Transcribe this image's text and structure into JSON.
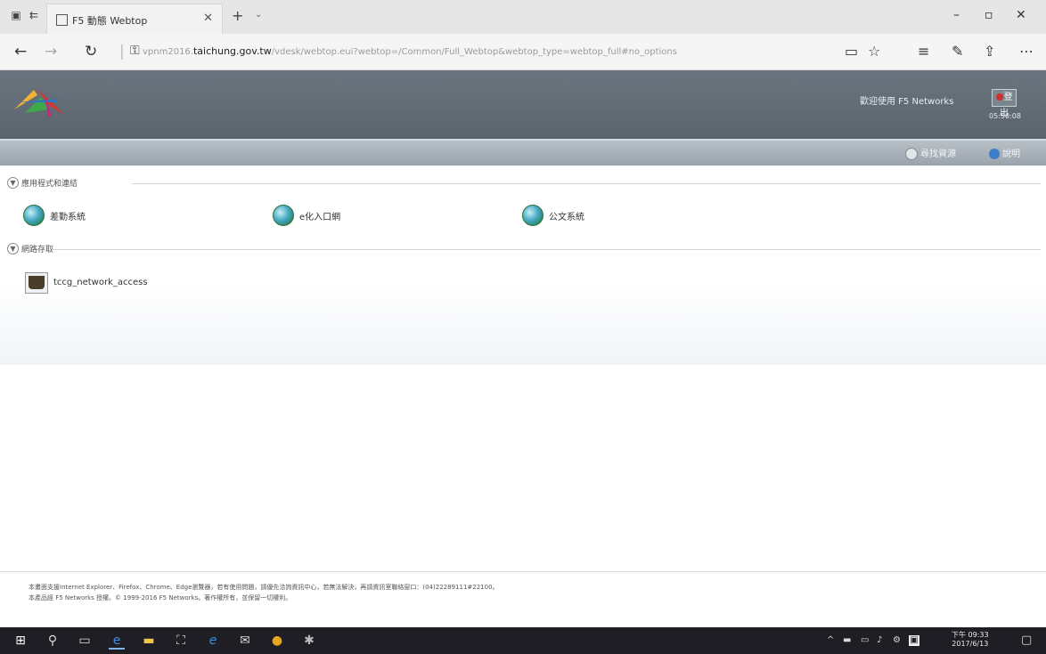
{
  "browser": {
    "tab_title": "F5 動態 Webtop",
    "url_prefix": "vpnm2016.",
    "url_domain": "taichung.gov.tw",
    "url_suffix": "/vdesk/webtop.eui?webtop=/Common/Full_Webtop&webtop_type=webtop_full#no_options"
  },
  "header": {
    "welcome": "歡迎使用 F5 Networks",
    "logout_label": "登出",
    "clock": "05:50:08"
  },
  "toolbar": {
    "find_resource": "尋找資源",
    "help": "說明"
  },
  "sections": {
    "applications": "應用程式和連結",
    "network_access": "網路存取"
  },
  "apps": [
    {
      "name": "差勤系統"
    },
    {
      "name": "e化入口網"
    },
    {
      "name": "公文系統"
    }
  ],
  "network_resource": {
    "name": "tccg_network_access"
  },
  "footer": {
    "line1": "本畫面支援Internet Explorer、Firefox、Chrome、Edge瀏覽器，若有使用問題，請優先洽詢資訊中心，若無法解決，再請資訊室聯絡窗口：(04)22289111#22100。",
    "line2": "本產品經 F5 Networks 授權。© 1999-2016 F5 Networks。著作權所有，並保留一切權利。"
  },
  "taskbar": {
    "time": "下午 09:33",
    "date": "2017/6/13"
  },
  "icons": [
    "tab-overview-icon",
    "back-tab-icon",
    "close-icon",
    "new-tab-icon",
    "minimize-icon",
    "maximize-icon",
    "back-icon",
    "forward-icon",
    "refresh-icon",
    "lock-icon",
    "reading-view-icon",
    "favorite-star-icon",
    "hub-icon",
    "notes-icon",
    "share-icon",
    "more-icon",
    "globe-icon",
    "network-access-icon",
    "windows-start-icon",
    "search-icon",
    "task-view-icon",
    "edge-icon",
    "explorer-icon",
    "store-icon",
    "ie-icon",
    "mail-icon",
    "chrome-icon",
    "app-icon",
    "notification-icon"
  ]
}
